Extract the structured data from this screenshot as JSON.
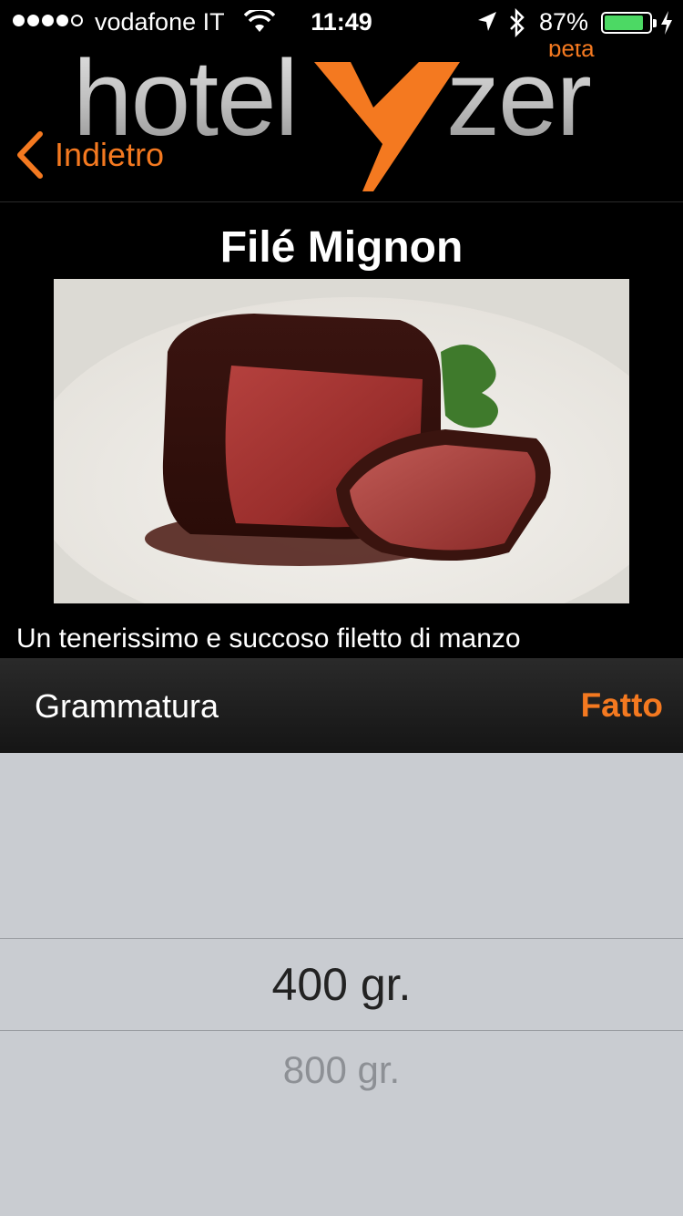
{
  "status_bar": {
    "carrier": "vodafone IT",
    "time": "11:49",
    "battery_percent_label": "87%",
    "battery_level": 0.87,
    "signal_bars_filled": 4,
    "signal_bars_total": 5
  },
  "nav": {
    "logo": {
      "text_main": "hotelyzer",
      "text_badge": "beta"
    },
    "back_label": "Indietro"
  },
  "dish": {
    "title": "Filé Mignon",
    "description": "Un tenerissimo e succoso filetto di manzo"
  },
  "picker": {
    "toolbar_title": "Grammatura",
    "done_label": "Fatto",
    "selected_value": "400 gr.",
    "options": [
      "400 gr.",
      "800 gr."
    ]
  },
  "colors": {
    "accent": "#f47920",
    "battery_green": "#4cd964",
    "picker_bg": "#c9ccd1"
  }
}
